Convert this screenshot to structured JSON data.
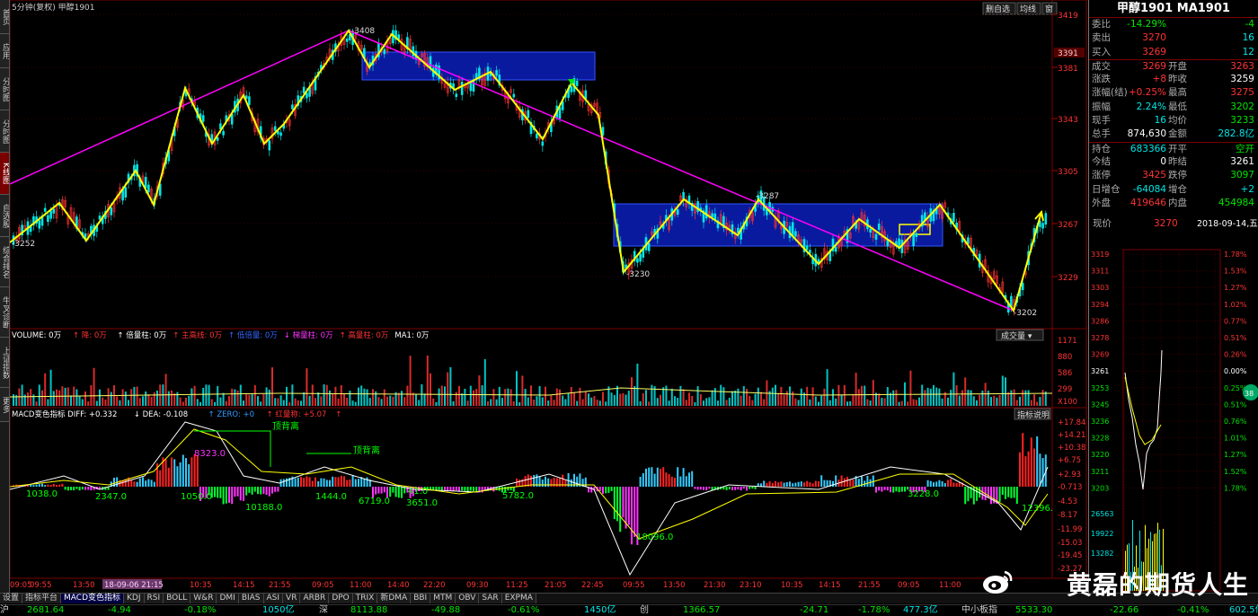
{
  "chart_title": "5分钟(复权)  甲醇1901",
  "top_controls": [
    "删自选",
    "均线",
    "窗"
  ],
  "left_tabs": [
    "分时图",
    "K线图",
    "自选股",
    "综合排名",
    "牛叉诊断",
    "上证指数",
    "更多"
  ],
  "left_tabs_top": [
    "首页",
    "应用",
    "分时图"
  ],
  "left_active": "K线图",
  "price_axis": [
    "3419",
    "3381",
    "3343",
    "3305",
    "3267",
    "3229"
  ],
  "current_price_tag": "3391",
  "price_labels": {
    "high": "3408",
    "low1": "3230",
    "low2": "3202",
    "mid": "3287",
    "start": "3252"
  },
  "volume_header": [
    {
      "text": "VOLUME: 0万",
      "color": "#ffffff"
    },
    {
      "text": "↑ 降: 0万",
      "color": "#ff3333"
    },
    {
      "text": "↑ 倍量柱: 0万",
      "color": "#ffffff"
    },
    {
      "text": "↑ 主高线: 0万",
      "color": "#ff3333"
    },
    {
      "text": "↑ 低倍量: 0万",
      "color": "#3366ff"
    },
    {
      "text": "↓ 梯量柱: 0万",
      "color": "#ff33ff"
    },
    {
      "text": "↑ 高量柱: 0万",
      "color": "#ff3333"
    },
    {
      "text": "MA1: 0万",
      "color": "#ffffff"
    }
  ],
  "volume_dropdown": "成交量",
  "volume_axis": [
    "1171",
    "880",
    "586",
    "299",
    "X100"
  ],
  "macd_header": [
    {
      "text": "MACD变色指标  DIFF: +0.332",
      "color": "#ffffff"
    },
    {
      "text": "↓ DEA: -0.108",
      "color": "#ffffff"
    },
    {
      "text": "↑ ZERO: +0",
      "color": "#3399ff"
    },
    {
      "text": "↑ 红量称: +5.07",
      "color": "#ff3333"
    },
    {
      "text": "↑",
      "color": "#ff3333"
    }
  ],
  "macd_button": "指标说明",
  "macd_axis": [
    "+17.84",
    "+14.21",
    "+10.38",
    "+6.75",
    "+2.93",
    "-0.713",
    "-4.53",
    "-8.17",
    "-11.99",
    "-15.03",
    "-19.45",
    "-23.27"
  ],
  "macd_labels": [
    "顶背离",
    "顶背离",
    "1038.0",
    "2347.0",
    "1050.0",
    "10188.0",
    "1444.0",
    "6719.0",
    "3651.0",
    "5782.0",
    "18096.0",
    "3228.0",
    "12396.",
    "41.0",
    "8323.0"
  ],
  "time_axis": [
    "09:05",
    "09:55",
    "13:50",
    "18-09-06 21:15",
    "10:35",
    "14:15",
    "21:55",
    "09:05",
    "11:00",
    "14:40",
    "22:20",
    "09:30",
    "11:25",
    "21:05",
    "22:45",
    "09:55",
    "13:50",
    "21:30",
    "23:10",
    "10:35",
    "14:15",
    "21:55",
    "09:05",
    "11:00"
  ],
  "bottom_tabs": [
    "设置",
    "指标平台",
    "MACD变色指标",
    "KDJ",
    "RSI",
    "BOLL",
    "W&R",
    "DMI",
    "BIAS",
    "ASI",
    "VR",
    "ARBR",
    "DPO",
    "TRIX",
    "新DMA",
    "BBI",
    "MTM",
    "OBV",
    "SAR",
    "EXPMA"
  ],
  "bottom_active": "MACD变色指标",
  "statusbar": [
    {
      "text": "沪",
      "color": "#ccc"
    },
    {
      "text": "2681.64",
      "color": "#00e600"
    },
    {
      "text": "-4.94",
      "color": "#00e600"
    },
    {
      "text": "-0.18%",
      "color": "#00e600"
    },
    {
      "text": "1050亿",
      "color": "#00e6e6"
    },
    {
      "text": "深",
      "color": "#ccc"
    },
    {
      "text": "8113.88",
      "color": "#00e600"
    },
    {
      "text": "-49.88",
      "color": "#00e600"
    },
    {
      "text": "-0.61%",
      "color": "#00e600"
    },
    {
      "text": "1450亿",
      "color": "#00e6e6"
    },
    {
      "text": "创",
      "color": "#ccc"
    },
    {
      "text": "1366.57",
      "color": "#00e600"
    },
    {
      "text": "-24.71",
      "color": "#00e600"
    },
    {
      "text": "-1.78%",
      "color": "#00e600"
    },
    {
      "text": "477.3亿",
      "color": "#00e6e6"
    },
    {
      "text": "中小板指",
      "color": "#ccc"
    },
    {
      "text": "5533.30",
      "color": "#00e600"
    },
    {
      "text": "-22.66",
      "color": "#00e600"
    },
    {
      "text": "-0.41%",
      "color": "#00e600"
    },
    {
      "text": "602.5亿",
      "color": "#00e6e6"
    }
  ],
  "quote": {
    "title": "甲醇1901 MA1901",
    "rows": [
      {
        "l1": "委比",
        "v1": "-14.29%",
        "c1": "green",
        "l2": "",
        "v2": "-4",
        "c2": "green"
      },
      {
        "l1": "卖出",
        "v1": "3270",
        "c1": "red",
        "l2": "",
        "v2": "16",
        "c2": "cyan"
      },
      {
        "l1": "买入",
        "v1": "3269",
        "c1": "red",
        "l2": "",
        "v2": "12",
        "c2": "cyan"
      },
      {
        "l1": "成交",
        "v1": "3269",
        "c1": "red",
        "l2": "开盘",
        "v2": "3263",
        "c2": "red"
      },
      {
        "l1": "涨跌",
        "v1": "+8",
        "c1": "red",
        "l2": "昨收",
        "v2": "3259",
        "c2": "white"
      },
      {
        "l1": "涨幅(结)",
        "v1": "+0.25%",
        "c1": "red",
        "l2": "最高",
        "v2": "3275",
        "c2": "red"
      },
      {
        "l1": "振幅",
        "v1": "2.24%",
        "c1": "cyan",
        "l2": "最低",
        "v2": "3202",
        "c2": "green"
      },
      {
        "l1": "现手",
        "v1": "16",
        "c1": "cyan",
        "l2": "均价",
        "v2": "3233",
        "c2": "green"
      },
      {
        "l1": "总手",
        "v1": "874,630",
        "c1": "white",
        "l2": "金额",
        "v2": "282.8亿",
        "c2": "cyan"
      },
      {
        "l1": "持仓",
        "v1": "683366",
        "c1": "cyan",
        "l2": "开平",
        "v2": "空开",
        "c2": "green"
      },
      {
        "l1": "今结",
        "v1": "0",
        "c1": "white",
        "l2": "昨结",
        "v2": "3261",
        "c2": "white"
      },
      {
        "l1": "涨停",
        "v1": "3425",
        "c1": "red",
        "l2": "跌停",
        "v2": "3097",
        "c2": "green"
      },
      {
        "l1": "日增仓",
        "v1": "-64084",
        "c1": "cyan",
        "l2": "增仓",
        "v2": "+2",
        "c2": "cyan"
      },
      {
        "l1": "外盘",
        "v1": "419646",
        "c1": "red",
        "l2": "内盘",
        "v2": "454984",
        "c2": "green"
      }
    ],
    "now_label": "现价",
    "now_value": "3270",
    "date": "2018-09-14,五"
  },
  "mini_price_axis": [
    "3319",
    "3311",
    "3303",
    "3294",
    "3286",
    "3278",
    "3269",
    "3261",
    "3253",
    "3245",
    "3236",
    "3228",
    "3220",
    "3211",
    "3203"
  ],
  "mini_pct_axis": [
    "1.78%",
    "1.53%",
    "1.27%",
    "1.02%",
    "0.77%",
    "0.51%",
    "0.26%",
    "0.00%",
    "0.25%",
    "0.51%",
    "0.76%",
    "1.01%",
    "1.27%",
    "1.52%",
    "1.78%"
  ],
  "mini_vol_axis": [
    "26563",
    "19922",
    "13282"
  ],
  "mini_badge": "38",
  "watermark": "黄磊的期货人生",
  "colors": {
    "zigzag": "#ffff00",
    "trendline": "#ff00ff",
    "box": "#0a1a9e",
    "up": "#ff3333",
    "down": "#00e6e6"
  }
}
